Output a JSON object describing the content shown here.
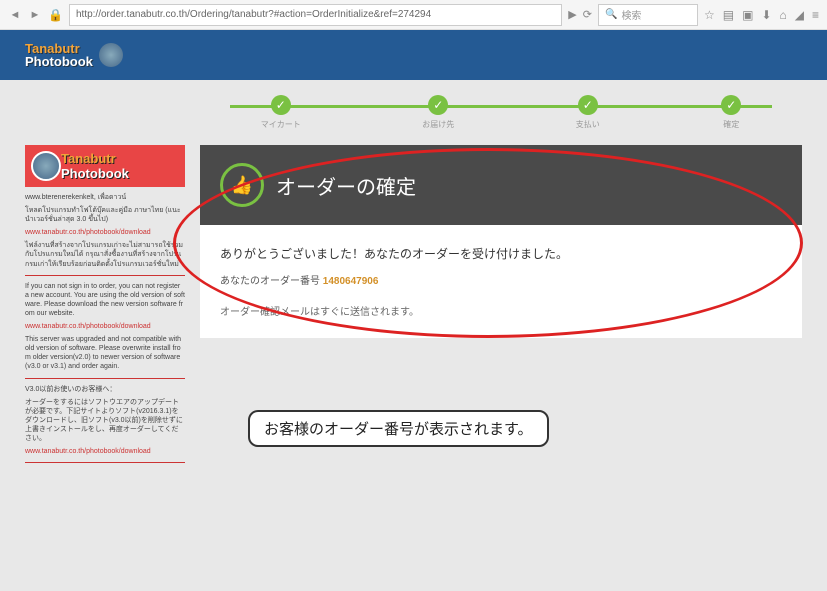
{
  "browser": {
    "url": "http://order.tanabutr.co.th/Ordering/tanabutr?#action=OrderInitialize&ref=274294",
    "search_placeholder": "検索"
  },
  "logo": {
    "line1": "Tanabutr",
    "line2": "Photobook"
  },
  "steps": [
    {
      "label": "マイカート"
    },
    {
      "label": "お届け先"
    },
    {
      "label": "支払い"
    },
    {
      "label": "確定"
    }
  ],
  "sidebar": {
    "banner": {
      "line1": "Tanabutr",
      "line2": "Photobook"
    },
    "p1": "www.bterenerekenkelt, เพื่อดาวน์",
    "p2": "โหลดโปรแกรมทำโฟโต้บุ๊คและคู่มือ ภาษาไทย (แนะนำเวอร์ชั่นล่าสุด 3.0 ขึ้นไป)",
    "link1": "www.tanabutr.co.th/photobook/download",
    "p3": "ไฟล์งานที่สร้างจากโปรแกรมเก่าจะไม่สามารถใช้ร่วมกับโปรแกรมใหม่ได้ กรุณาสั่งซื้องานที่สร้างจากโปรแกรมเก่าให้เรียบร้อยก่อนติดตั้งโปรแกรมเวอร์ชั่นใหม่",
    "p4": "If you can not sign in to order, you can not register a new account. You are using the old version of software. Please download the new version software from our website.",
    "link2": "www.tanabutr.co.th/photobook/download",
    "p5": "This server was upgraded and not compatible with old version of software. Please overwrite install from older version(v2.0) to newer version of software (v3.0 or v3.1) and order again.",
    "p6": "V3.0以前お使いのお客様へ：",
    "p7": "オーダーをするにはソフトウエアのアップデートが必要です。下記サイトよりソフト(v2016.3.1)をダウンロードし、旧ソフト(v3.0以前)を削除せずに上書きインストールをし、再度オーダーしてください。",
    "link3": "www.tanabutr.co.th/photobook/download"
  },
  "confirm": {
    "title": "オーダーの確定",
    "thanks": "ありがとうございました！あなたのオーダーを受け付けました。",
    "order_label": "あなたのオーダー番号",
    "order_number": "1480647906",
    "note": "オーダー確認メールはすぐに送信されます。"
  },
  "callout": "お客様のオーダー番号が表示されます。"
}
